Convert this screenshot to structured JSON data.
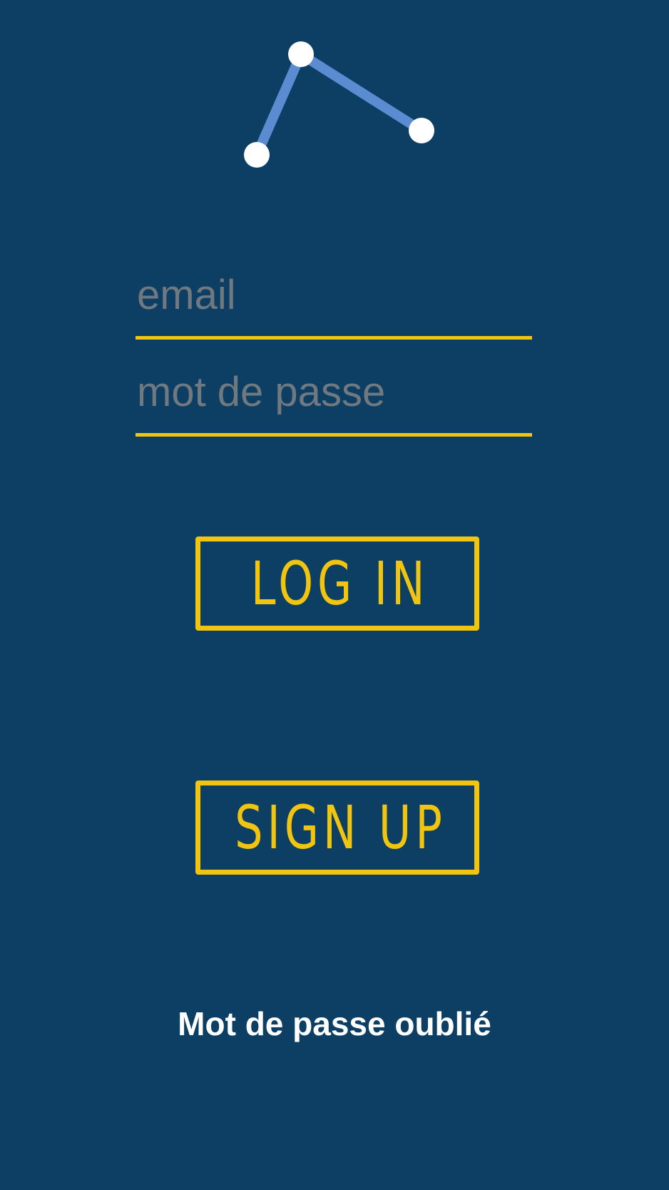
{
  "logo": {
    "icon": "connected-nodes-logo",
    "line_color": "#5b8bd0",
    "node_color": "#ffffff"
  },
  "form": {
    "email_placeholder": "email",
    "password_placeholder": "mot de passe"
  },
  "buttons": {
    "login_label": "LOG IN",
    "signup_label": "SIGN UP"
  },
  "links": {
    "forgot_password": "Mot de passe oublié"
  },
  "colors": {
    "background": "#0c3f63",
    "accent": "#f1c40f",
    "placeholder": "#707880",
    "text": "#ffffff"
  }
}
